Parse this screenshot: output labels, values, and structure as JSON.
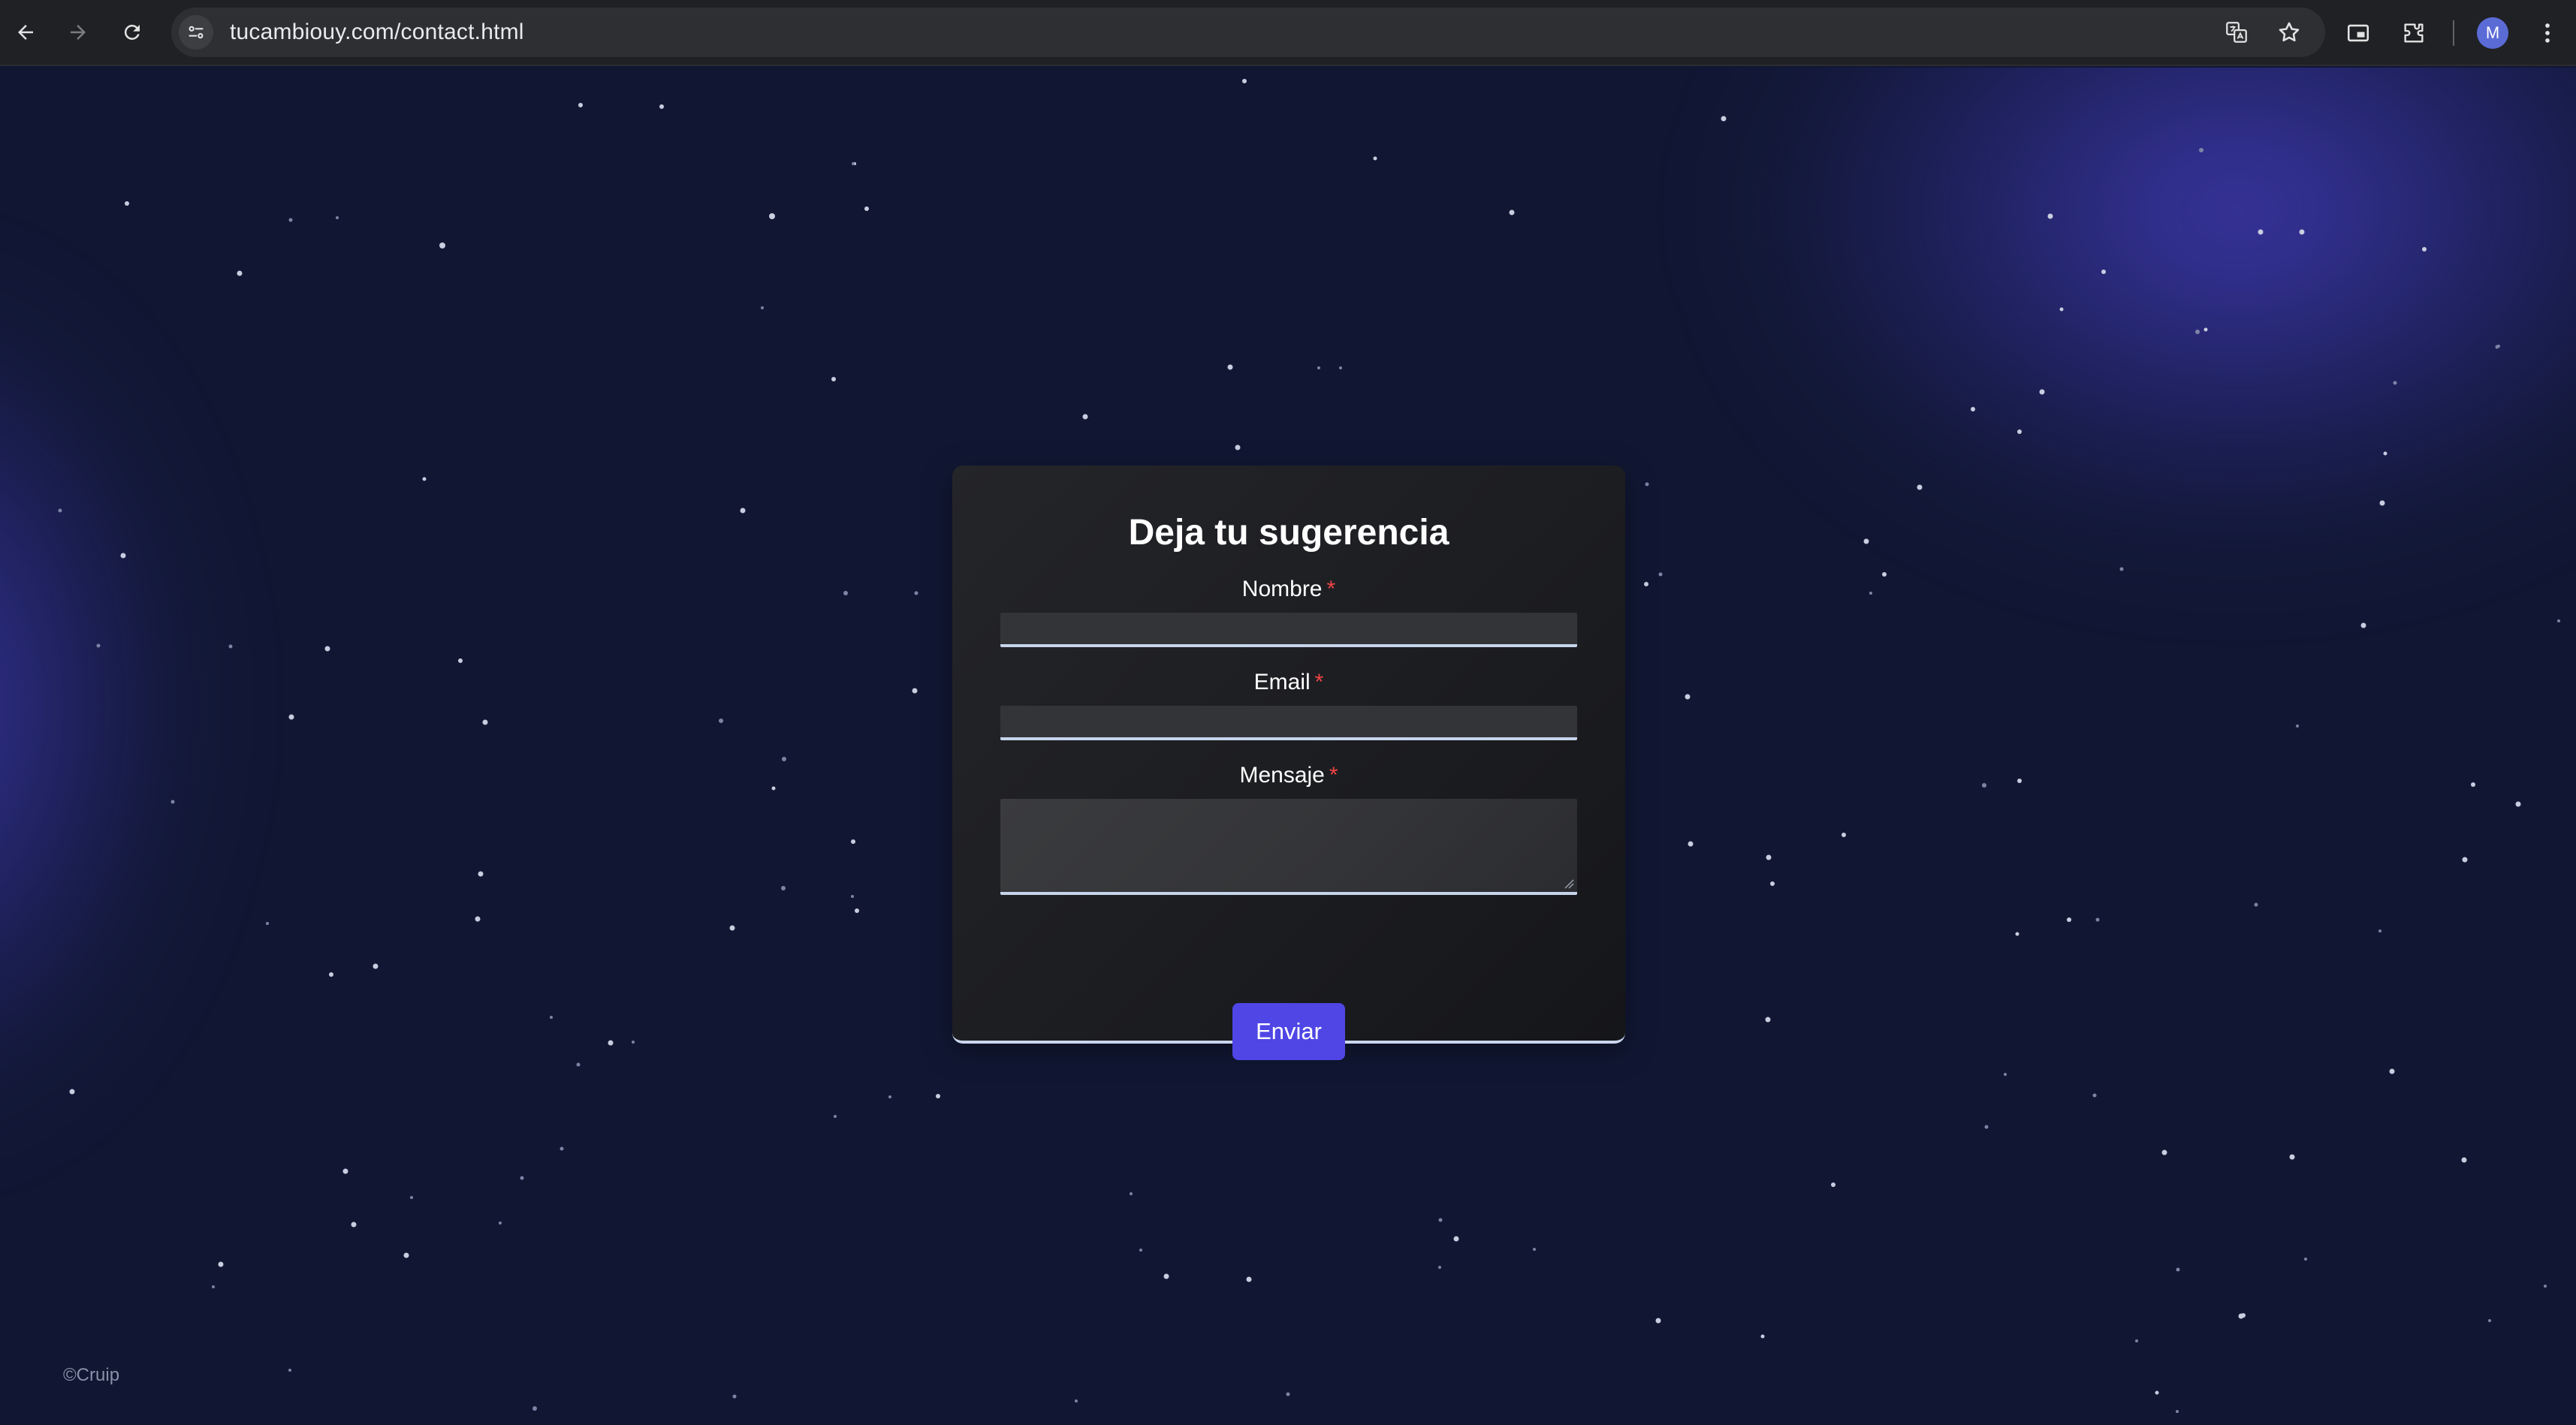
{
  "browser": {
    "url": "tucambiouy.com/contact.html",
    "profile_initial": "M",
    "icons": [
      "back-icon",
      "forward-icon",
      "reload-icon",
      "site-info-icon",
      "translate-icon",
      "star-icon",
      "cast-icon",
      "extensions-icon",
      "menu-icon"
    ]
  },
  "form": {
    "title": "Deja tu sugerencia",
    "fields": [
      {
        "label": "Nombre",
        "required_mark": "*",
        "value": ""
      },
      {
        "label": "Email",
        "required_mark": "*",
        "value": ""
      },
      {
        "label": "Mensaje",
        "required_mark": "*",
        "value": ""
      }
    ],
    "submit_label": "Enviar"
  },
  "footer": {
    "text": "©Cruip"
  },
  "colors": {
    "background": "#111733",
    "glow": "#4e46dc",
    "card": "#1e1f23",
    "accent_button": "#4f46e5",
    "required": "#ef4444",
    "field_underline": "#c6d4ec"
  }
}
